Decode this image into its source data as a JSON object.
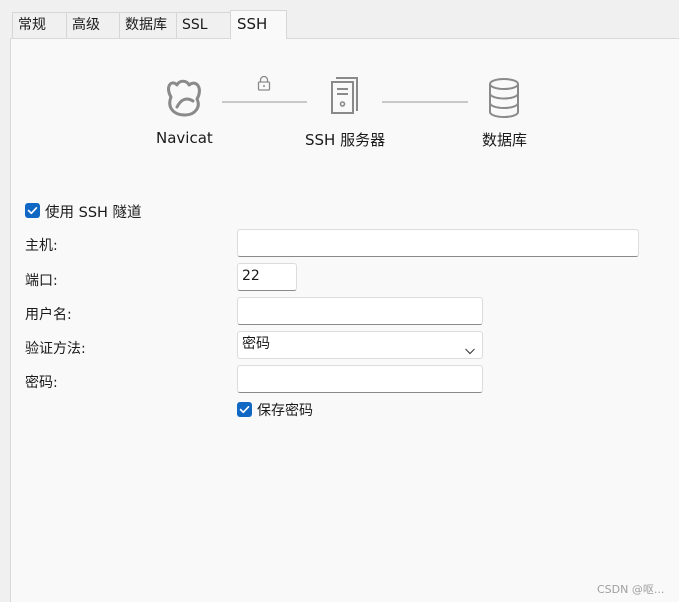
{
  "tabs": [
    {
      "label": "常规",
      "active": false
    },
    {
      "label": "高级",
      "active": false
    },
    {
      "label": "数据库",
      "active": false
    },
    {
      "label": "SSL",
      "active": false
    },
    {
      "label": "SSH",
      "active": true
    }
  ],
  "diagram": {
    "client_label": "Navicat",
    "server_label": "SSH 服务器",
    "database_label": "数据库",
    "client_icon": "navicat-logo-icon",
    "lock_icon": "lock-icon",
    "server_icon": "server-icon",
    "database_icon": "database-icon"
  },
  "form": {
    "use_tunnel": {
      "label": "使用 SSH 隧道",
      "checked": true
    },
    "host": {
      "label": "主机:",
      "value": ""
    },
    "port": {
      "label": "端口:",
      "value": "22"
    },
    "username": {
      "label": "用户名:",
      "value": ""
    },
    "auth_method": {
      "label": "验证方法:",
      "value": "密码"
    },
    "password": {
      "label": "密码:",
      "value": ""
    },
    "save_password": {
      "label": "保存密码",
      "checked": true
    }
  },
  "watermark": "CSDN @呕...",
  "colors": {
    "accent": "#1167c4",
    "icon_gray": "#8a8a8a"
  }
}
